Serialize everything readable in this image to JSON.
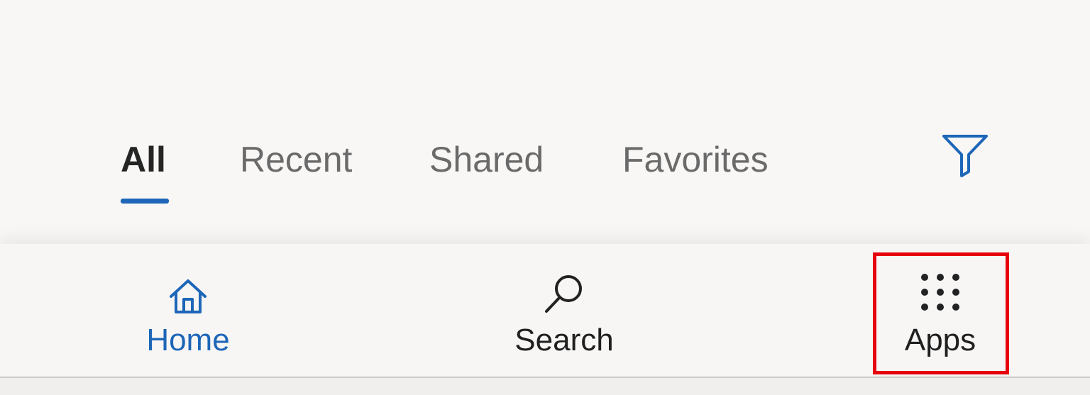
{
  "tabs": {
    "items": [
      {
        "label": "All",
        "active": true
      },
      {
        "label": "Recent",
        "active": false
      },
      {
        "label": "Shared",
        "active": false
      },
      {
        "label": "Favorites",
        "active": false
      }
    ],
    "filter_icon": "filter-icon"
  },
  "bottom_nav": {
    "items": [
      {
        "label": "Home",
        "icon": "home-icon",
        "active": true
      },
      {
        "label": "Search",
        "icon": "search-icon",
        "active": false
      },
      {
        "label": "Apps",
        "icon": "apps-grid-icon",
        "active": false,
        "highlighted": true
      }
    ]
  },
  "colors": {
    "accent": "#1d66b8",
    "highlight": "#e6000b",
    "background": "#f8f7f6"
  }
}
